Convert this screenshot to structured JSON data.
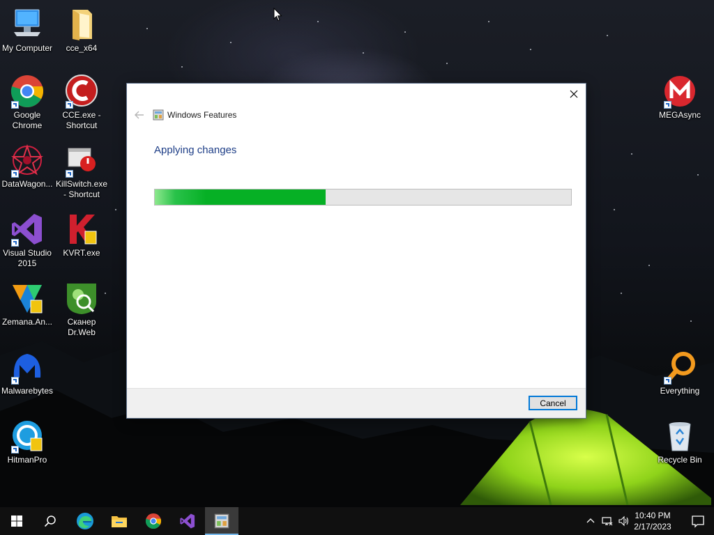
{
  "desktop": {
    "icons": [
      {
        "id": "my-computer",
        "label": "My Computer",
        "shortcut": false
      },
      {
        "id": "cce-x64",
        "label": "cce_x64",
        "shortcut": false
      },
      {
        "id": "google-chrome",
        "label": "Google Chrome",
        "shortcut": true
      },
      {
        "id": "cce-exe",
        "label": "CCE.exe - Shortcut",
        "shortcut": true
      },
      {
        "id": "datawagon",
        "label": "DataWagon...",
        "shortcut": true
      },
      {
        "id": "killswitch",
        "label": "KillSwitch.exe - Shortcut",
        "shortcut": true
      },
      {
        "id": "visual-studio",
        "label": "Visual Studio 2015",
        "shortcut": true
      },
      {
        "id": "kvrt",
        "label": "KVRT.exe",
        "shortcut": false
      },
      {
        "id": "zemana",
        "label": "Zemana.An...",
        "shortcut": false
      },
      {
        "id": "drweb",
        "label": "Сканер Dr.Web",
        "shortcut": false
      },
      {
        "id": "malwarebytes",
        "label": "Malwarebytes",
        "shortcut": true
      },
      {
        "id": "hitmanpro",
        "label": "HitmanPro",
        "shortcut": true
      },
      {
        "id": "megasync",
        "label": "MEGAsync",
        "shortcut": true
      },
      {
        "id": "everything",
        "label": "Everything",
        "shortcut": true
      },
      {
        "id": "recycle-bin",
        "label": "Recycle Bin",
        "shortcut": false
      }
    ]
  },
  "dialog": {
    "window_title": "Windows Features",
    "heading": "Applying changes",
    "progress_percent": 41,
    "progress_color": "#06b025",
    "cancel_label": "Cancel",
    "close_icon": "close-icon",
    "back_icon": "back-arrow-icon"
  },
  "taskbar": {
    "items": [
      {
        "id": "start",
        "icon": "windows-logo-icon"
      },
      {
        "id": "search",
        "icon": "search-icon"
      },
      {
        "id": "edge",
        "icon": "edge-icon"
      },
      {
        "id": "file-explorer",
        "icon": "folder-icon"
      },
      {
        "id": "chrome",
        "icon": "chrome-icon"
      },
      {
        "id": "visual-studio",
        "icon": "visual-studio-icon"
      },
      {
        "id": "windows-features",
        "icon": "windows-features-icon",
        "active": true
      }
    ],
    "tray": {
      "time": "10:40 PM",
      "date": "2/17/2023"
    }
  }
}
